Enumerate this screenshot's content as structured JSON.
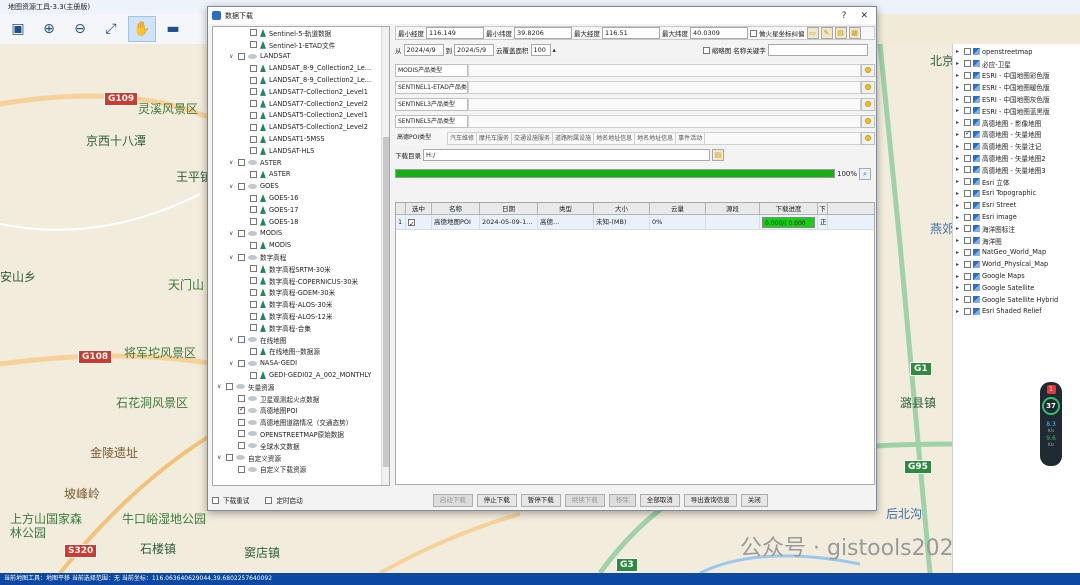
{
  "app": {
    "title": "地图资源工具-3.3(主册版)"
  },
  "status_bar": {
    "text": "当前地图工具：地图平移  当前选择范围：无  当前坐标：116.063640629044,39.6802257640092"
  },
  "map": {
    "labels": [
      "灵溪风景区",
      "京西十八潭",
      "王平镇",
      "安山乡",
      "天门山",
      "将军坨风景区",
      "石花洞风景区",
      "金陵遗址",
      "坡峰岭",
      "上方山国家森林公园",
      "牛口峪湿地公园",
      "石楼镇",
      "窦店镇",
      "北京",
      "燕郊",
      "潞县镇",
      "后北沟",
      "公众号 · gistools2021"
    ],
    "shields": [
      "G109",
      "G108",
      "S320",
      "G1",
      "G95",
      "G3"
    ]
  },
  "layers": [
    {
      "label": "openstreetmap",
      "checked": false
    },
    {
      "label": "必应-卫星",
      "checked": false
    },
    {
      "label": "ESRI - 中国地图彩色版",
      "checked": false
    },
    {
      "label": "ESRI - 中国地图暖色版",
      "checked": false
    },
    {
      "label": "ESRI - 中国地图灰色版",
      "checked": false
    },
    {
      "label": "ESRI - 中国地图蓝黑版",
      "checked": false
    },
    {
      "label": "高德地图 - 影像地图",
      "checked": false
    },
    {
      "label": "高德地图 - 矢量地图",
      "checked": true
    },
    {
      "label": "高德地图 - 矢量注记",
      "checked": false
    },
    {
      "label": "高德地图 - 矢量地图2",
      "checked": false
    },
    {
      "label": "高德地图 - 矢量地图3",
      "checked": false
    },
    {
      "label": "Esri 立体",
      "checked": false
    },
    {
      "label": "Esri Topographic",
      "checked": false
    },
    {
      "label": "Esri Street",
      "checked": false
    },
    {
      "label": "Esri image",
      "checked": false
    },
    {
      "label": "海洋图标注",
      "checked": false
    },
    {
      "label": "海洋图",
      "checked": false
    },
    {
      "label": "NatGeo_World_Map",
      "checked": false
    },
    {
      "label": "World_Physical_Map",
      "checked": false
    },
    {
      "label": "Google Maps",
      "checked": false
    },
    {
      "label": "Google Satellite",
      "checked": false
    },
    {
      "label": "Google Satellite Hybrid",
      "checked": false
    },
    {
      "label": "Esri Shaded Relief",
      "checked": false
    }
  ],
  "widget": {
    "badge": "1",
    "value": "37",
    "unit": "%",
    "up": "8.3",
    "up_unit": "K/s",
    "down": "9.6",
    "down_unit": "K/s"
  },
  "dialog": {
    "title": "数据下载",
    "help": "?",
    "close": "✕",
    "tree": [
      {
        "level": 2,
        "expander": "",
        "checked": false,
        "icon": "green",
        "label": "Sentinel-5-轨道数据"
      },
      {
        "level": 2,
        "expander": "",
        "checked": false,
        "icon": "green",
        "label": "Sentinel-1-ETAD文件"
      },
      {
        "level": 1,
        "expander": "∨",
        "checked": false,
        "icon": "gray",
        "label": "LANDSAT"
      },
      {
        "level": 2,
        "expander": "",
        "checked": false,
        "icon": "green",
        "label": "LANDSAT_8-9_Collection2_Le..."
      },
      {
        "level": 2,
        "expander": "",
        "checked": false,
        "icon": "green",
        "label": "LANDSAT_8-9_Collection2_Le..."
      },
      {
        "level": 2,
        "expander": "",
        "checked": false,
        "icon": "green",
        "label": "LANDSAT7-Collection2_Level1"
      },
      {
        "level": 2,
        "expander": "",
        "checked": false,
        "icon": "green",
        "label": "LANDSAT7-Collection2_Level2"
      },
      {
        "level": 2,
        "expander": "",
        "checked": false,
        "icon": "green",
        "label": "LANDSAT5-Collection2_Level1"
      },
      {
        "level": 2,
        "expander": "",
        "checked": false,
        "icon": "green",
        "label": "LANDSAT5-Collection2_Level2"
      },
      {
        "level": 2,
        "expander": "",
        "checked": false,
        "icon": "green",
        "label": "LANDSAT1-5MSS"
      },
      {
        "level": 2,
        "expander": "",
        "checked": false,
        "icon": "green",
        "label": "LANDSAT-HLS"
      },
      {
        "level": 1,
        "expander": "∨",
        "checked": false,
        "icon": "gray",
        "label": "ASTER"
      },
      {
        "level": 2,
        "expander": "",
        "checked": false,
        "icon": "green",
        "label": "ASTER"
      },
      {
        "level": 1,
        "expander": "∨",
        "checked": false,
        "icon": "gray",
        "label": "GOES"
      },
      {
        "level": 2,
        "expander": "",
        "checked": false,
        "icon": "green",
        "label": "GOES-16"
      },
      {
        "level": 2,
        "expander": "",
        "checked": false,
        "icon": "green",
        "label": "GOES-17"
      },
      {
        "level": 2,
        "expander": "",
        "checked": false,
        "icon": "green",
        "label": "GOES-18"
      },
      {
        "level": 1,
        "expander": "∨",
        "checked": false,
        "icon": "gray",
        "label": "MODIS"
      },
      {
        "level": 2,
        "expander": "",
        "checked": false,
        "icon": "green",
        "label": "MODIS"
      },
      {
        "level": 1,
        "expander": "∨",
        "checked": false,
        "icon": "gray",
        "label": "数字高程"
      },
      {
        "level": 2,
        "expander": "",
        "checked": false,
        "icon": "green",
        "label": "数字高程SRTM-30米"
      },
      {
        "level": 2,
        "expander": "",
        "checked": false,
        "icon": "green",
        "label": "数字高程-COPERNICUS-30米"
      },
      {
        "level": 2,
        "expander": "",
        "checked": false,
        "icon": "green",
        "label": "数字高程-GDEM-30米"
      },
      {
        "level": 2,
        "expander": "",
        "checked": false,
        "icon": "green",
        "label": "数字高程-ALOS-30米"
      },
      {
        "level": 2,
        "expander": "",
        "checked": false,
        "icon": "green",
        "label": "数字高程-ALOS-12米"
      },
      {
        "level": 2,
        "expander": "",
        "checked": false,
        "icon": "green",
        "label": "数字高程-合集"
      },
      {
        "level": 1,
        "expander": "∨",
        "checked": false,
        "icon": "gray",
        "label": "在线地图"
      },
      {
        "level": 2,
        "expander": "",
        "checked": false,
        "icon": "green",
        "label": "在线地图--数据源"
      },
      {
        "level": 1,
        "expander": "∨",
        "checked": false,
        "icon": "gray",
        "label": "NASA-GEDI"
      },
      {
        "level": 2,
        "expander": "",
        "checked": false,
        "icon": "green",
        "label": "GEDI-GEDI02_A_002_MONTHLY"
      },
      {
        "level": 0,
        "expander": "∨",
        "checked": false,
        "icon": "gray",
        "label": "矢量资源"
      },
      {
        "level": 1,
        "expander": "",
        "checked": false,
        "icon": "gray",
        "label": "卫星观测起火点数据"
      },
      {
        "level": 1,
        "expander": "",
        "checked": true,
        "icon": "gray",
        "label": "高德地图POI"
      },
      {
        "level": 1,
        "expander": "",
        "checked": false,
        "icon": "gray",
        "label": "高德地图道路情况（交通态势）"
      },
      {
        "level": 1,
        "expander": "",
        "checked": false,
        "icon": "gray",
        "label": "OPENSTREETMAP原始数据"
      },
      {
        "level": 1,
        "expander": "",
        "checked": false,
        "icon": "gray",
        "label": "全球水文数据"
      },
      {
        "level": 0,
        "expander": "∨",
        "checked": false,
        "icon": "gray",
        "label": "自定义资源"
      },
      {
        "level": 1,
        "expander": "",
        "checked": false,
        "icon": "gray",
        "label": "自定义下载资源"
      }
    ],
    "coords": {
      "min_lon_label": "最小经度",
      "min_lon": "116.149",
      "min_lat_label": "最小纬度",
      "min_lat": "39.8206",
      "max_lon_label": "最大经度",
      "max_lon": "116.51",
      "max_lat_label": "最大纬度",
      "max_lat": "40.0309",
      "mars_label": "做火星坐标纠偏"
    },
    "dates": {
      "from_label": "从",
      "from": "2024/4/9",
      "to_label": "到",
      "to": "2024/5/9",
      "cloud_label": "云覆盖面积",
      "cloud": "100",
      "thumb_label": "缩略图",
      "name_kw_label": "名称关键字"
    },
    "products": [
      {
        "label": "MODIS产品类型"
      },
      {
        "label": "SENTINEL1-ETAD产品类型"
      },
      {
        "label": "SENTINEL3产品类型"
      },
      {
        "label": "SENTINEL5产品类型"
      }
    ],
    "poi": {
      "label": "高德POI类型",
      "tabs": [
        "汽车维修",
        "摩托车服务",
        "交通设施服务",
        "道路附属设施",
        "地名地址信息",
        "地名地址信息",
        "事件活动"
      ]
    },
    "download_dir": {
      "label": "下载目录",
      "value": "H:/"
    },
    "progress": {
      "value": 100,
      "text": "100%"
    },
    "grid": {
      "columns": [
        "选中",
        "名称",
        "日期",
        "类型",
        "大小",
        "云量",
        "源段",
        "下载进度",
        "下"
      ],
      "rows": [
        {
          "index": "1",
          "checked": true,
          "name": "高德地图POI",
          "date": "2024-05-09-1...",
          "type": "高德...",
          "size": "未知-(MB)",
          "cloud": "0%",
          "source": "",
          "progress": "0.000/(   0.000",
          "status": "正在下"
        }
      ]
    },
    "bottom": {
      "resume_label": "下载重试",
      "timer_label": "定时启动",
      "buttons": [
        {
          "label": "启动下载",
          "disabled": true
        },
        {
          "label": "停止下载",
          "disabled": false
        },
        {
          "label": "暂停下载",
          "disabled": false
        },
        {
          "label": "继续下载",
          "disabled": true
        },
        {
          "label": "移除",
          "disabled": true
        },
        {
          "label": "全部取消",
          "disabled": false
        },
        {
          "label": "导出查询信息",
          "disabled": false
        },
        {
          "label": "关闭",
          "disabled": false
        }
      ]
    }
  },
  "colors": {
    "accent": "#0d49a3",
    "progress": "#16b016",
    "road_shield": "#cf3a2c",
    "expressway": "#2d8a3f"
  }
}
